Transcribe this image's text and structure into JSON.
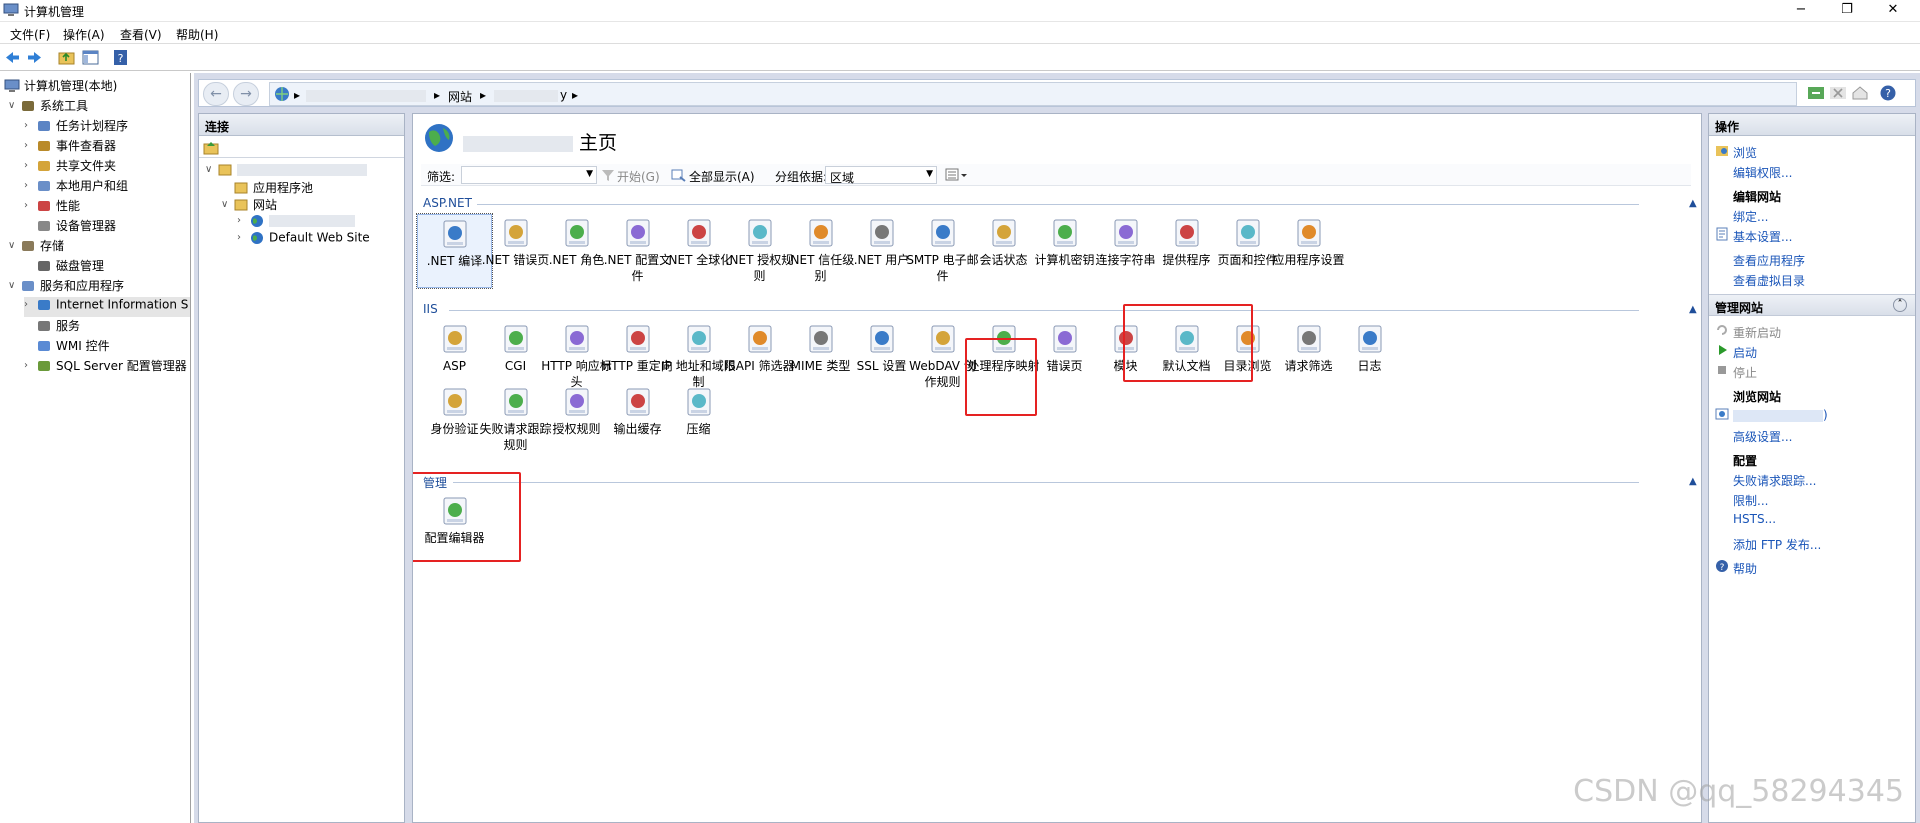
{
  "window": {
    "title": "计算机管理",
    "min": "−",
    "max": "❐",
    "close": "✕"
  },
  "menu": [
    "文件(F)",
    "操作(A)",
    "查看(V)",
    "帮助(H)"
  ],
  "tree": {
    "root": "计算机管理(本地)",
    "items": [
      {
        "label": "系统工具",
        "level": 1,
        "expand": "∨"
      },
      {
        "label": "任务计划程序",
        "level": 2,
        "expand": "›"
      },
      {
        "label": "事件查看器",
        "level": 2,
        "expand": "›"
      },
      {
        "label": "共享文件夹",
        "level": 2,
        "expand": "›"
      },
      {
        "label": "本地用户和组",
        "level": 2,
        "expand": "›"
      },
      {
        "label": "性能",
        "level": 2,
        "expand": "›"
      },
      {
        "label": "设备管理器",
        "level": 2,
        "expand": ""
      },
      {
        "label": "存储",
        "level": 1,
        "expand": "∨"
      },
      {
        "label": "磁盘管理",
        "level": 2,
        "expand": ""
      },
      {
        "label": "服务和应用程序",
        "level": 1,
        "expand": "∨"
      },
      {
        "label": "Internet Information S",
        "level": 2,
        "expand": "›",
        "selected": true
      },
      {
        "label": "服务",
        "level": 2,
        "expand": ""
      },
      {
        "label": "WMI 控件",
        "level": 2,
        "expand": ""
      },
      {
        "label": "SQL Server 配置管理器",
        "level": 2,
        "expand": "›"
      }
    ]
  },
  "address": {
    "back": "←",
    "fwd": "→",
    "seg_sites": "网站",
    "sep": "▸",
    "seg_tail": "y"
  },
  "connections": {
    "title": "连接",
    "items": [
      {
        "label": "",
        "level": 0,
        "expand": "∨"
      },
      {
        "label": "应用程序池",
        "level": 1,
        "expand": ""
      },
      {
        "label": "网站",
        "level": 1,
        "expand": "∨"
      },
      {
        "label": "",
        "level": 2,
        "expand": "›"
      },
      {
        "label": "Default Web Site",
        "level": 2,
        "expand": "›"
      }
    ]
  },
  "main": {
    "title_suffix": "主页",
    "filter_label": "筛选:",
    "start_label": "开始(G)",
    "show_all": "全部显示(A)",
    "group_by": "分组依据:",
    "group_value": "区域",
    "groups": [
      {
        "name": "ASP.NET",
        "items": [
          ".NET 编译",
          ".NET 错误页",
          ".NET 角色",
          ".NET 配置文件",
          ".NET 全球化",
          ".NET 授权规则",
          ".NET 信任级别",
          ".NET 用户",
          "SMTP 电子邮件",
          "会话状态",
          "计算机密钥",
          "连接字符串",
          "提供程序",
          "页面和控件",
          "应用程序设置"
        ]
      },
      {
        "name": "IIS",
        "items": [
          "ASP",
          "CGI",
          "HTTP 响应标头",
          "HTTP 重定向",
          "IP 地址和域限制",
          "ISAPI 筛选器",
          "MIME 类型",
          "SSL 设置",
          "WebDAV 创作规则",
          "处理程序映射",
          "错误页",
          "模块",
          "默认文档",
          "目录浏览",
          "请求筛选",
          "日志",
          "身份验证",
          "失败请求跟踪规则",
          "授权规则",
          "输出缓存",
          "压缩"
        ]
      },
      {
        "name": "管理",
        "items": [
          "配置编辑器"
        ]
      }
    ]
  },
  "actions": {
    "title": "操作",
    "browse": "浏览",
    "edit_perm": "编辑权限...",
    "edit_site": "编辑网站",
    "bind": "绑定...",
    "basic": "基本设置...",
    "view_apps": "查看应用程序",
    "view_vdirs": "查看虚拟目录",
    "manage_site": "管理网站",
    "restart": "重新启动",
    "start": "启动",
    "stop": "停止",
    "browse_site": "浏览网站",
    "browse_suffix": ")",
    "advanced": "高级设置...",
    "config": "配置",
    "fail_trace": "失败请求跟踪...",
    "limits": "限制...",
    "hsts": "HSTS...",
    "ftp": "添加 FTP 发布...",
    "help": "帮助"
  },
  "watermark": "CSDN @qq_58294345"
}
